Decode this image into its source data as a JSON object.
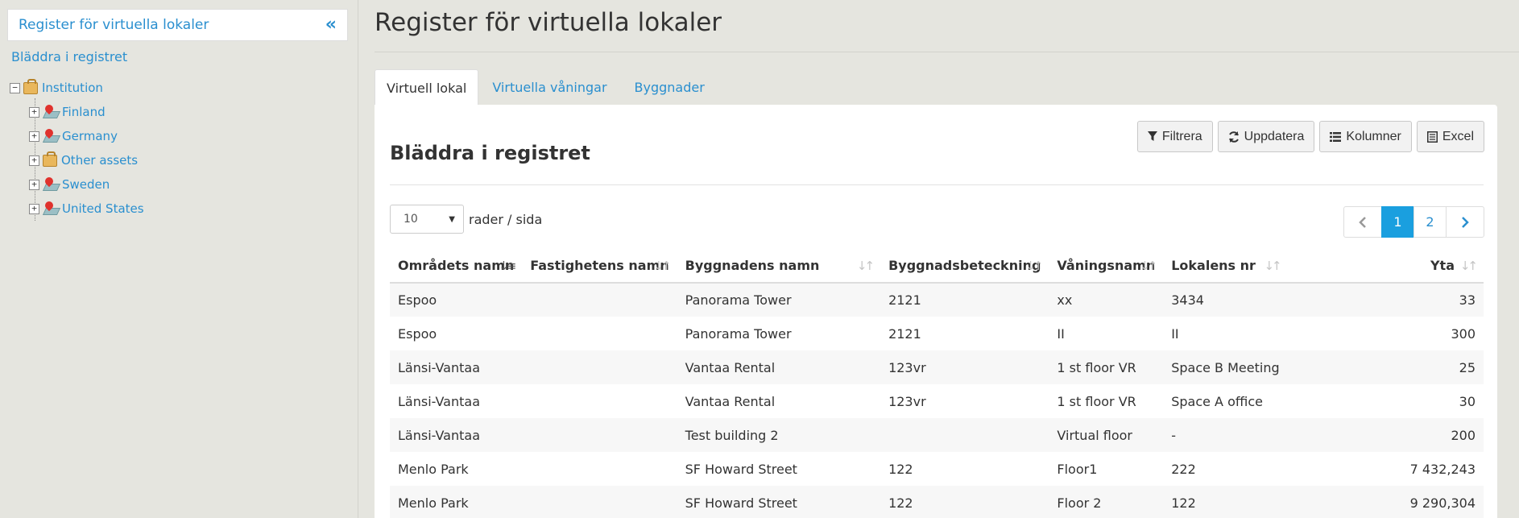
{
  "sidebar": {
    "title": "Register för virtuella lokaler",
    "collapse_icon": "«",
    "browse_link": "Bläddra i registret",
    "tree": {
      "root": {
        "label": "Institution",
        "expander": "−"
      },
      "children": [
        {
          "label": "Finland",
          "icon": "location-pin-icon",
          "expander": "+"
        },
        {
          "label": "Germany",
          "icon": "location-pin-icon",
          "expander": "+"
        },
        {
          "label": "Other assets",
          "icon": "briefcase-icon",
          "expander": "+"
        },
        {
          "label": "Sweden",
          "icon": "location-pin-icon",
          "expander": "+"
        },
        {
          "label": "United States",
          "icon": "location-pin-icon",
          "expander": "+"
        }
      ]
    }
  },
  "header": {
    "title": "Register för virtuella lokaler"
  },
  "tabs": [
    {
      "label": "Virtuell lokal",
      "active": true
    },
    {
      "label": "Virtuella våningar",
      "active": false
    },
    {
      "label": "Byggnader",
      "active": false
    }
  ],
  "panel": {
    "title": "Bläddra i registret",
    "toolbar": {
      "filter": "Filtrera",
      "refresh": "Uppdatera",
      "columns": "Kolumner",
      "excel": "Excel"
    },
    "page_size": {
      "value": "10",
      "label": "rader / sida"
    },
    "pagination": {
      "pages": [
        "1",
        "2"
      ],
      "current": "1",
      "prev": "‹",
      "next": "›"
    }
  },
  "table": {
    "columns": [
      "Områdets namn",
      "Fastighetens namn",
      "Byggnadens namn",
      "Byggnadsbeteckning",
      "Våningsnamn",
      "Lokalens nr",
      "Yta"
    ],
    "rows": [
      [
        "Espoo",
        "",
        "Panorama Tower",
        "2121",
        "xx",
        "3434",
        "33"
      ],
      [
        "Espoo",
        "",
        "Panorama Tower",
        "2121",
        "II",
        "II",
        "300"
      ],
      [
        "Länsi-Vantaa",
        "",
        "Vantaa Rental",
        "123vr",
        "1 st floor VR",
        "Space B Meeting",
        "25"
      ],
      [
        "Länsi-Vantaa",
        "",
        "Vantaa Rental",
        "123vr",
        "1 st floor VR",
        "Space A office",
        "30"
      ],
      [
        "Länsi-Vantaa",
        "",
        "Test building 2",
        "",
        "Virtual floor",
        "-",
        "200"
      ],
      [
        "Menlo Park",
        "",
        "SF Howard Street",
        "122",
        "Floor1",
        "222",
        "7 432,243"
      ],
      [
        "Menlo Park",
        "",
        "SF Howard Street",
        "122",
        "Floor 2",
        "122",
        "9 290,304"
      ]
    ]
  },
  "colors": {
    "link": "#2a8fcf",
    "active_page": "#1a9fdf",
    "background": "#e5e5df"
  }
}
